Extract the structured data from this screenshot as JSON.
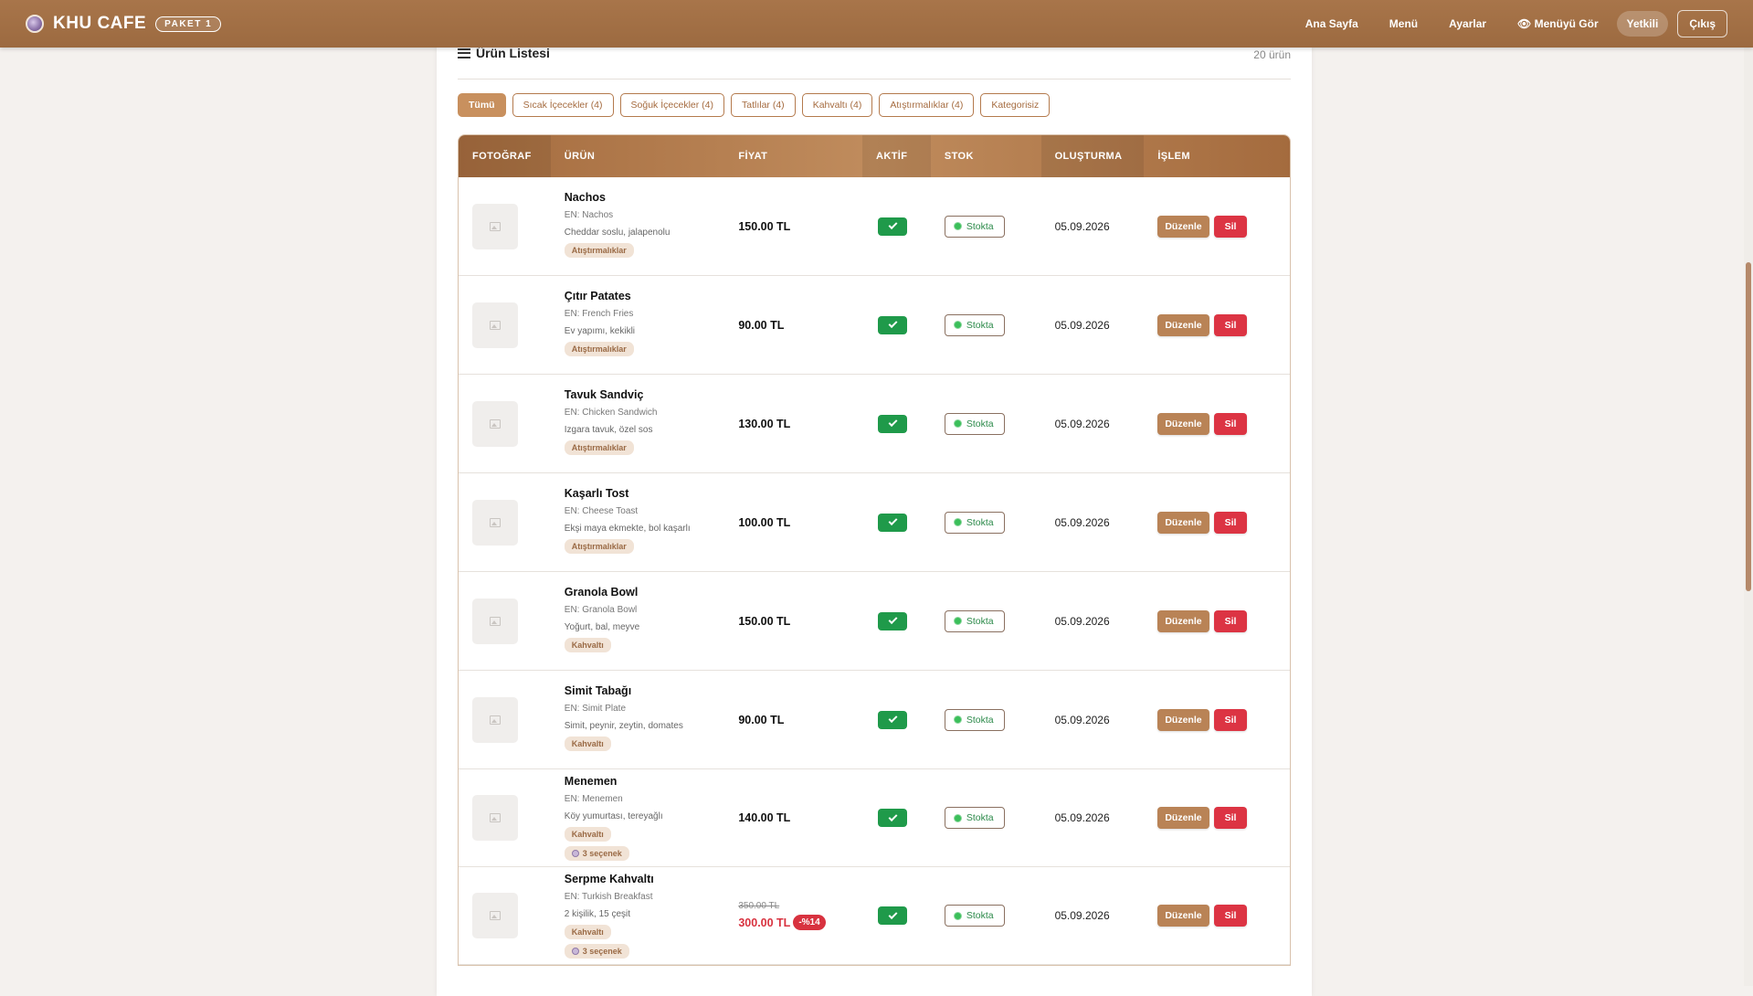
{
  "header": {
    "brand": "KHU CAFE",
    "plan": "PAKET 1",
    "nav": [
      {
        "label": "Ana Sayfa"
      },
      {
        "label": "Menü"
      },
      {
        "label": "Ayarlar"
      },
      {
        "label": "👁 Menüyü Gör"
      }
    ],
    "role_label": "Yetkili",
    "logout_label": "Çıkış"
  },
  "panel": {
    "title": "Ürün Listesi",
    "count": "20 ürün"
  },
  "filters": [
    {
      "label": "Tümü",
      "active": true
    },
    {
      "label": "Sıcak İçecekler (4)"
    },
    {
      "label": "Soğuk İçecekler (4)"
    },
    {
      "label": "Tatlılar (4)"
    },
    {
      "label": "Kahvaltı (4)"
    },
    {
      "label": "Atıştırmalıklar (4)"
    },
    {
      "label": "Kategorisiz"
    }
  ],
  "table": {
    "columns": [
      "FOTOĞRAF",
      "ÜRÜN",
      "FİYAT",
      "AKTİF",
      "STOK",
      "OLUŞTURMA",
      "İŞLEM"
    ],
    "stock_label": "Stokta",
    "edit_label": "Düzenle",
    "delete_label": "Sil",
    "rows": [
      {
        "name": "Nachos",
        "en": "EN: Nachos",
        "desc": "Cheddar soslu, jalapenolu",
        "category": "Atıştırmalıklar",
        "price": "150.00 TL",
        "date": "05.09.2026"
      },
      {
        "name": "Çıtır Patates",
        "en": "EN: French Fries",
        "desc": "Ev yapımı, kekikli",
        "category": "Atıştırmalıklar",
        "price": "90.00 TL",
        "date": "05.09.2026"
      },
      {
        "name": "Tavuk Sandviç",
        "en": "EN: Chicken Sandwich",
        "desc": "Izgara tavuk, özel sos",
        "category": "Atıştırmalıklar",
        "price": "130.00 TL",
        "date": "05.09.2026"
      },
      {
        "name": "Kaşarlı Tost",
        "en": "EN: Cheese Toast",
        "desc": "Ekşi maya ekmekte, bol kaşarlı",
        "category": "Atıştırmalıklar",
        "price": "100.00 TL",
        "date": "05.09.2026"
      },
      {
        "name": "Granola Bowl",
        "en": "EN: Granola Bowl",
        "desc": "Yoğurt, bal, meyve",
        "category": "Kahvaltı",
        "price": "150.00 TL",
        "date": "05.09.2026"
      },
      {
        "name": "Simit Tabağı",
        "en": "EN: Simit Plate",
        "desc": "Simit, peynir, zeytin, domates",
        "category": "Kahvaltı",
        "price": "90.00 TL",
        "date": "05.09.2026"
      },
      {
        "name": "Menemen",
        "en": "EN: Menemen",
        "desc": "Köy yumurtası, tereyağlı",
        "category": "Kahvaltı",
        "options": "3 seçenek",
        "price": "140.00 TL",
        "date": "05.09.2026"
      },
      {
        "name": "Serpme Kahvaltı",
        "en": "EN: Turkish Breakfast",
        "desc": "2 kişilik, 15 çeşit",
        "category": "Kahvaltı",
        "options": "3 seçenek",
        "old_price": "350.00 TL",
        "price": "300.00 TL",
        "discount": "-%14",
        "date": "05.09.2026"
      }
    ]
  }
}
